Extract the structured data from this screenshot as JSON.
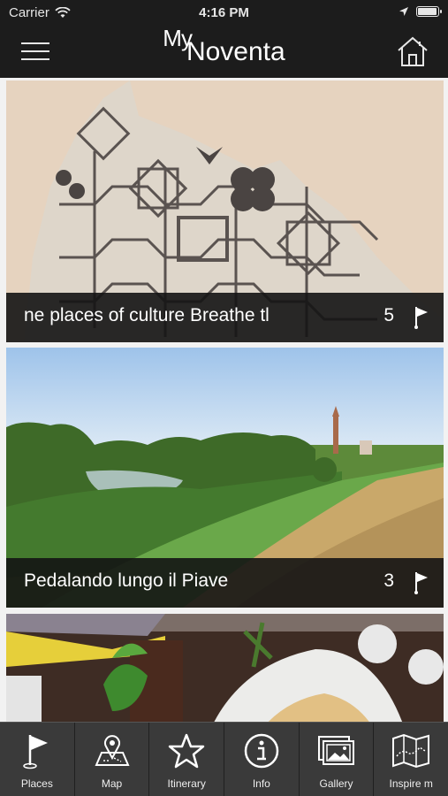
{
  "status_bar": {
    "carrier": "Carrier",
    "time": "4:16 PM",
    "battery_level": 0.95
  },
  "header": {
    "logo_my": "My",
    "logo_name": "Noventa",
    "menu_icon": "hamburger-menu-icon",
    "home_icon": "home-icon"
  },
  "cards": [
    {
      "title": "ne places of culture Breathe tl",
      "count": "5",
      "icon": "flag-icon"
    },
    {
      "title": "Pedalando lungo il Piave",
      "count": "3",
      "icon": "flag-icon"
    }
  ],
  "tabs": [
    {
      "label": "Places",
      "icon": "flag-icon"
    },
    {
      "label": "Map",
      "icon": "map-pin-icon"
    },
    {
      "label": "Itinerary",
      "icon": "star-icon"
    },
    {
      "label": "Info",
      "icon": "info-icon"
    },
    {
      "label": "Gallery",
      "icon": "gallery-icon"
    },
    {
      "label": "Inspire m",
      "icon": "folded-map-icon"
    }
  ],
  "colors": {
    "bar_background": "#1c1c1c",
    "tab_background": "#3a3a3a",
    "caption_background": "#141414"
  }
}
